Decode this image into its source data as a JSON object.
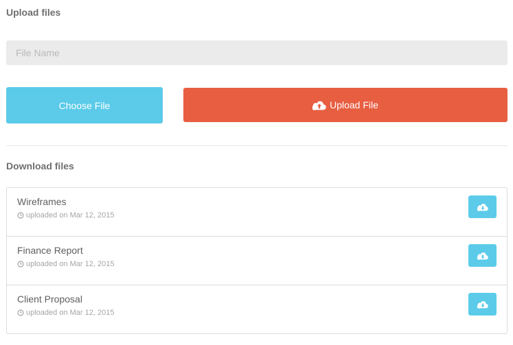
{
  "upload": {
    "title": "Upload files",
    "file_name_placeholder": "File Name",
    "choose_label": "Choose File",
    "upload_label": "Upload File",
    "upload_icon": "cloud-upload-icon"
  },
  "download": {
    "title": "Download files",
    "items": [
      {
        "name": "Wireframes",
        "meta": "uploaded on Mar 12, 2015",
        "icon": "cloud-download-icon"
      },
      {
        "name": "Finance Report",
        "meta": "uploaded on Mar 12, 2015",
        "icon": "cloud-download-icon"
      },
      {
        "name": "Client Proposal",
        "meta": "uploaded on Mar 12, 2015",
        "icon": "cloud-download-icon"
      }
    ]
  },
  "colors": {
    "accent_blue": "#5bcbe9",
    "accent_red": "#e85e41",
    "input_bg": "#ebebeb"
  }
}
